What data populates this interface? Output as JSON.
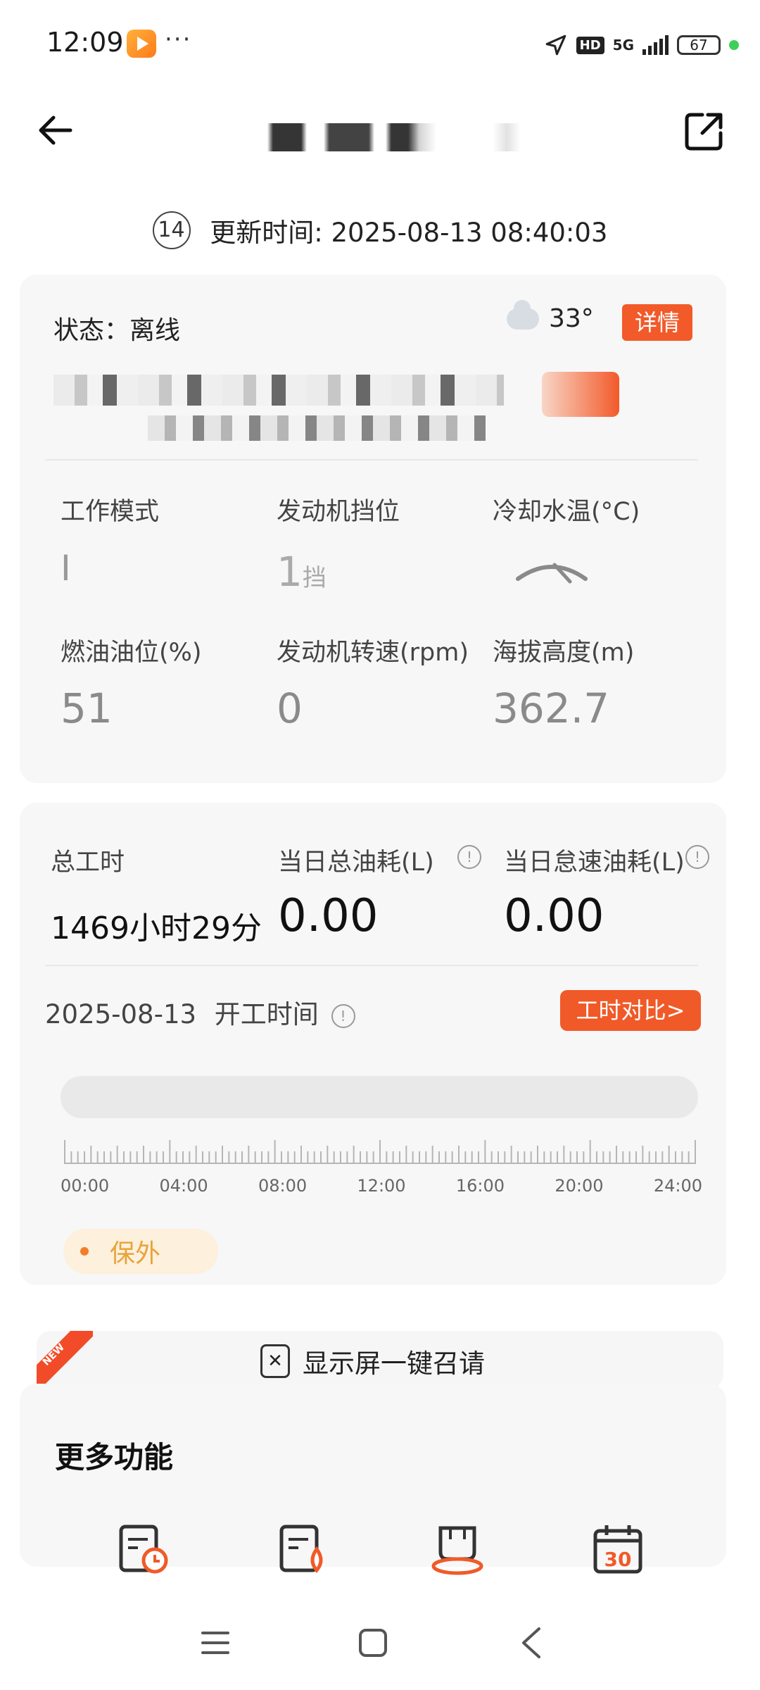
{
  "status_bar": {
    "time": "12:09",
    "dots": "···",
    "network_hd": "HD",
    "network_5g": "5G",
    "battery": "67",
    "icons": [
      "app-icon",
      "location-arrow-icon",
      "signal-icon",
      "battery-icon"
    ]
  },
  "header": {
    "update_number": "14",
    "update_text": "更新时间: 2025-08-13 08:40:03"
  },
  "machine_card": {
    "status": "状态：离线",
    "temperature": "33°",
    "detail_button": "详情",
    "metrics": [
      {
        "label": "工作模式",
        "value": "I",
        "unit": ""
      },
      {
        "label": "发动机挡位",
        "value": "1",
        "unit": "挡"
      },
      {
        "label": "冷却水温(°C)",
        "value": "",
        "unit": ""
      },
      {
        "label": "燃油油位(%)",
        "value": "51",
        "unit": ""
      },
      {
        "label": "发动机转速(rpm)",
        "value": "0",
        "unit": ""
      },
      {
        "label": "海拔高度(m)",
        "value": "362.7",
        "unit": ""
      }
    ]
  },
  "work_card": {
    "total_hours_label": "总工时",
    "total_hours_value": "1469小时29分",
    "daily_fuel_label": "当日总油耗(L)",
    "daily_fuel_value": "0.00",
    "idle_fuel_label": "当日怠速油耗(L)",
    "idle_fuel_value": "0.00",
    "info_glyph": "!",
    "date": "2025-08-13",
    "start_time_label": "开工时间",
    "compare_button": "工时对比>",
    "timeline_labels": [
      "00:00",
      "04:00",
      "08:00",
      "12:00",
      "16:00",
      "20:00",
      "24:00"
    ],
    "warranty": "保外"
  },
  "recall": {
    "new_tag": "NEW",
    "label": "显示屏一键召请"
  },
  "more": {
    "title": "更多功能",
    "calendar_number": "30",
    "icons": [
      "schedule-report-icon",
      "fuel-report-icon",
      "machine-area-icon",
      "calendar-icon"
    ]
  },
  "colors": {
    "accent": "#f25a2a",
    "card_bg": "#f7f7f7",
    "warranty_bg": "#fdf0dc",
    "warranty_text": "#e8a33a"
  }
}
